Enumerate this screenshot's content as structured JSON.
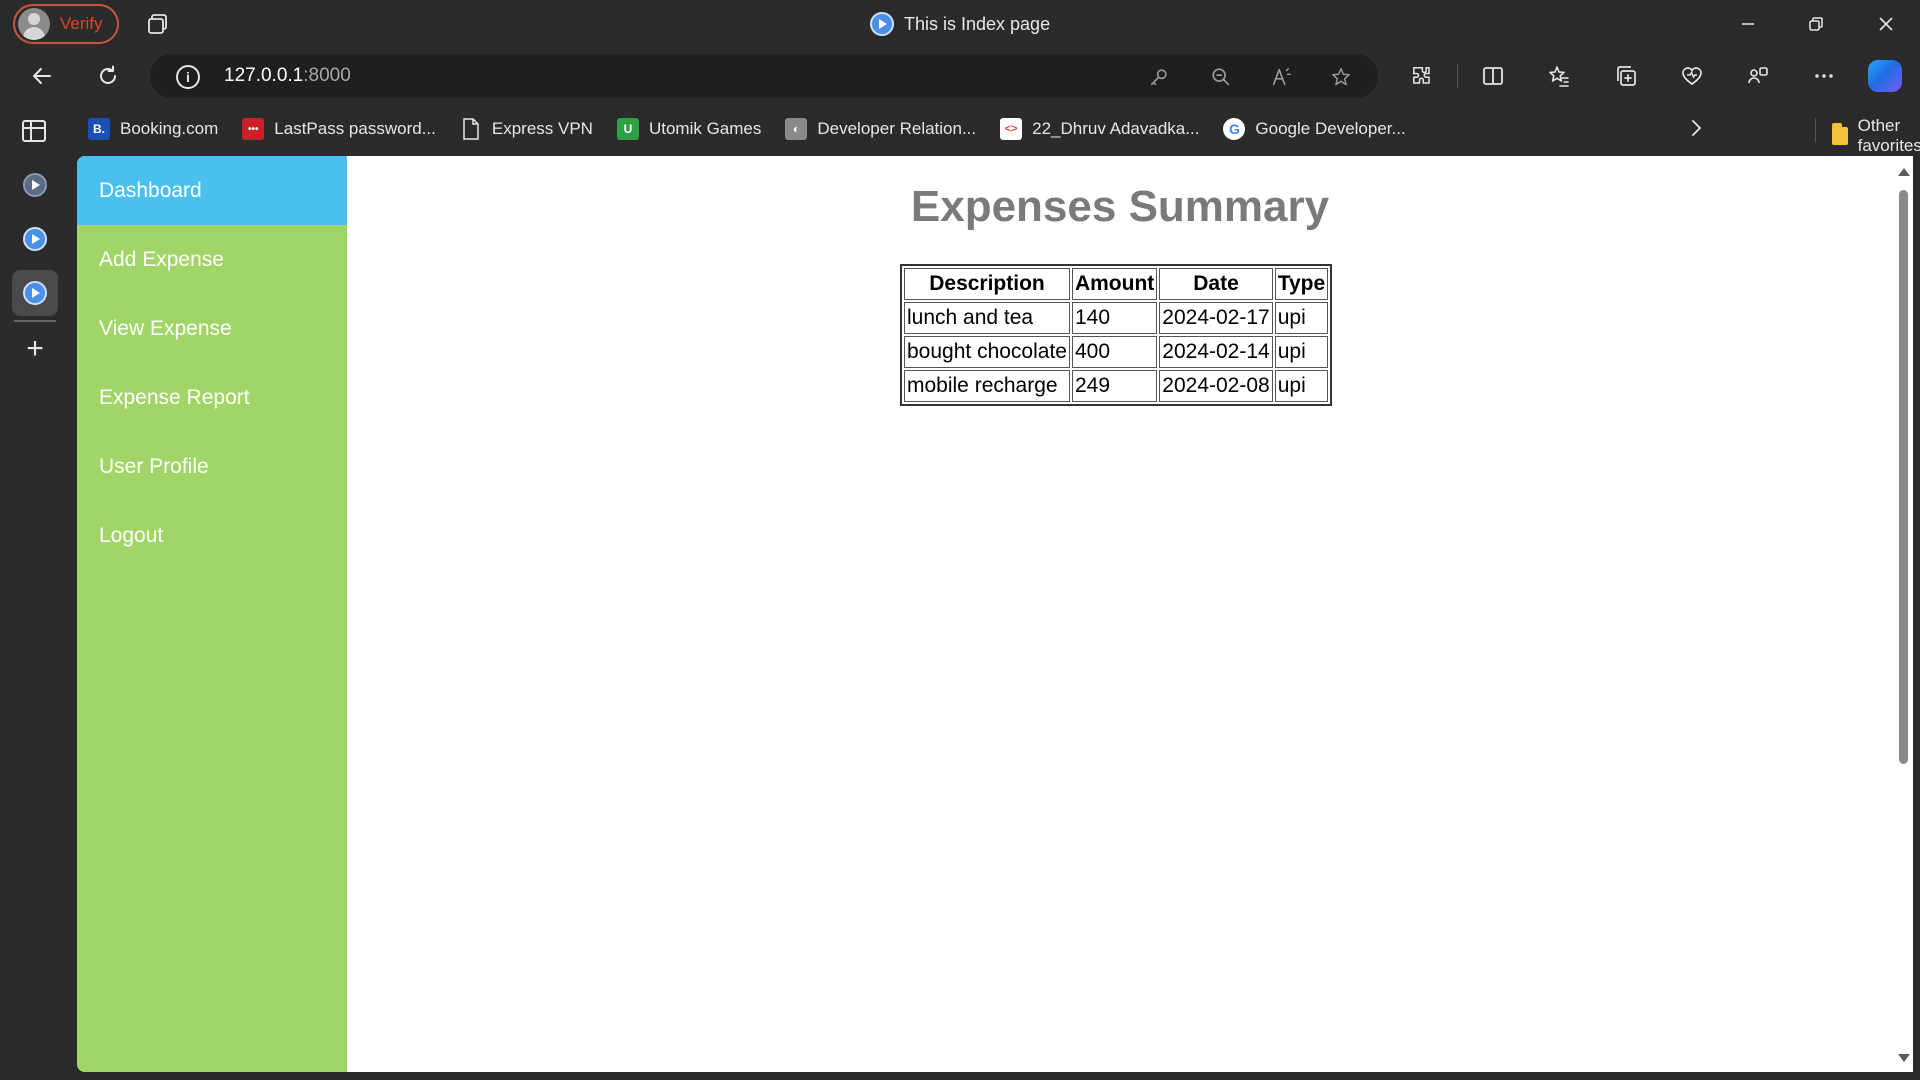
{
  "titlebar": {
    "profile_label": "Verify",
    "window_title": "This is Index page"
  },
  "address": {
    "host": "127.0.0.1",
    "port": ":8000"
  },
  "favorites": [
    {
      "label": "Booking.com",
      "icon": "booking-icon",
      "color": "#1a4fb5",
      "glyph": "B."
    },
    {
      "label": "LastPass password...",
      "icon": "lastpass-icon",
      "color": "#cc2029",
      "glyph": "•••"
    },
    {
      "label": "Express VPN",
      "icon": "page-icon",
      "color": "",
      "glyph": ""
    },
    {
      "label": "Utomik Games",
      "icon": "utomik-icon",
      "color": "#2fa043",
      "glyph": "U"
    },
    {
      "label": "Developer Relation...",
      "icon": "devrel-icon",
      "color": "#8a8a8a",
      "glyph": "◐"
    },
    {
      "label": "22_Dhruv Adavadka...",
      "icon": "code-icon",
      "color": "#ffffff",
      "glyph": "<>"
    },
    {
      "label": "Google Developer...",
      "icon": "google-icon",
      "color": "#ffffff",
      "glyph": "G"
    }
  ],
  "favorites_other": "Other favorites",
  "sidebar": {
    "items": [
      {
        "label": "Dashboard",
        "active": true
      },
      {
        "label": "Add Expense",
        "active": false
      },
      {
        "label": "View Expense",
        "active": false
      },
      {
        "label": "Expense Report",
        "active": false
      },
      {
        "label": "User Profile",
        "active": false
      },
      {
        "label": "Logout",
        "active": false
      }
    ]
  },
  "main": {
    "title": "Expenses Summary",
    "table": {
      "headers": [
        "Description",
        "Amount",
        "Date",
        "Type"
      ],
      "rows": [
        [
          "lunch and tea",
          "140",
          "2024-02-17",
          "upi"
        ],
        [
          "bought chocolate",
          "400",
          "2024-02-14",
          "upi"
        ],
        [
          "mobile recharge",
          "249",
          "2024-02-08",
          "upi"
        ]
      ]
    }
  },
  "colors": {
    "sidebar_bg": "#a2d568",
    "sidebar_active": "#4bc0ee",
    "title_text": "#7a7a7a",
    "chrome_bg": "#2b2b2b"
  }
}
